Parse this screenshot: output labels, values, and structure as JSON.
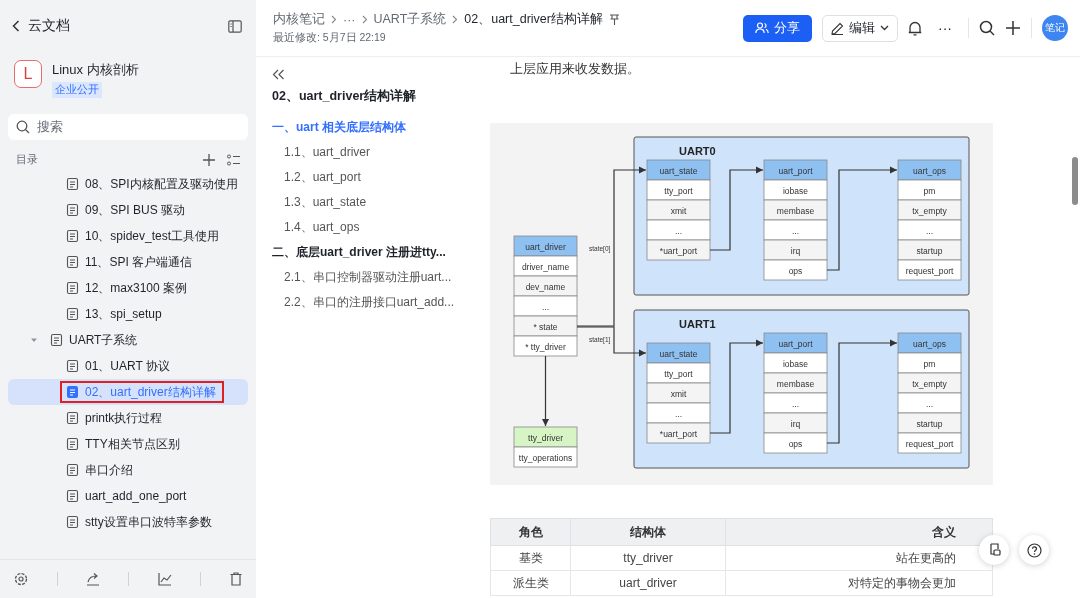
{
  "sidebar": {
    "back_label": "云文档",
    "space": {
      "initial": "L",
      "name": "Linux 内核剖析",
      "badge": "企业公开"
    },
    "search": {
      "placeholder": "搜索"
    },
    "toc_label": "目录",
    "tree_above": [
      {
        "label": "08、SPI内核配置及驱动使用",
        "selected": false,
        "highlighted": false
      },
      {
        "label": "09、SPI BUS 驱动",
        "selected": false,
        "highlighted": false
      },
      {
        "label": "10、spidev_test工具使用",
        "selected": false,
        "highlighted": false
      },
      {
        "label": "11、SPI 客户端通信",
        "selected": false,
        "highlighted": false
      },
      {
        "label": "12、max3100 案例",
        "selected": false,
        "highlighted": false
      },
      {
        "label": "13、spi_setup",
        "selected": false,
        "highlighted": false
      }
    ],
    "tree": [
      {
        "label": "UART子系统",
        "expanded": true,
        "selected": false,
        "highlighted": false,
        "children": [
          {
            "label": "01、UART 协议",
            "selected": false,
            "highlighted": false
          },
          {
            "label": "02、uart_driver结构详解",
            "selected": true,
            "highlighted": true
          },
          {
            "label": "printk执行过程",
            "selected": false,
            "highlighted": false
          },
          {
            "label": "TTY相关节点区别",
            "selected": false,
            "highlighted": false
          },
          {
            "label": "串口介绍",
            "selected": false,
            "highlighted": false
          },
          {
            "label": "uart_add_one_port",
            "selected": false,
            "highlighted": false
          },
          {
            "label": "stty设置串口波特率参数",
            "selected": false,
            "highlighted": false
          }
        ]
      }
    ]
  },
  "header": {
    "breadcrumb": [
      "内核笔记",
      "···",
      "UART子系统",
      "02、uart_driver结构详解"
    ],
    "last_modified": "最近修改: 5月7日 22:19",
    "share_button": "分享",
    "edit_button": "编辑",
    "more": "···",
    "avatar": "笔记"
  },
  "outline": {
    "title": "02、uart_driver结构详解",
    "sections": [
      {
        "label": "一、uart 相关底层结构体",
        "selected": true,
        "children": [
          {
            "label": "1.1、uart_driver"
          },
          {
            "label": "1.2、uart_port"
          },
          {
            "label": "1.3、uart_state"
          },
          {
            "label": "1.4、uart_ops"
          }
        ]
      },
      {
        "label": "二、底层uart_driver 注册进tty...",
        "selected": false,
        "children": [
          {
            "label": "2.1、串口控制器驱动注册uart..."
          },
          {
            "label": "2.2、串口的注册接口uart_add..."
          }
        ]
      }
    ]
  },
  "document": {
    "paragraph": "上层应用来收发数据。",
    "diagram": {
      "driver": {
        "title": "uart_driver",
        "fields": [
          "driver_name",
          "dev_name",
          "...",
          "* state",
          "* tty_driver"
        ]
      },
      "tty": {
        "title": "tty_driver",
        "fields": [
          "tty_operations"
        ]
      },
      "links": [
        "state[0]",
        "state[1]"
      ],
      "groups": [
        {
          "title": "UART0",
          "structs": [
            {
              "title": "uart_state",
              "fields": [
                "tty_port",
                "xmit",
                "...",
                "*uart_port"
              ]
            },
            {
              "title": "uart_port",
              "fields": [
                "iobase",
                "membase",
                "...",
                "irq",
                "ops"
              ]
            },
            {
              "title": "uart_ops",
              "fields": [
                "pm",
                "tx_empty",
                "...",
                "startup",
                "request_port"
              ]
            }
          ]
        },
        {
          "title": "UART1",
          "structs": [
            {
              "title": "uart_state",
              "fields": [
                "tty_port",
                "xmit",
                "...",
                "*uart_port"
              ]
            },
            {
              "title": "uart_port",
              "fields": [
                "iobase",
                "membase",
                "...",
                "irq",
                "ops"
              ]
            },
            {
              "title": "uart_ops",
              "fields": [
                "pm",
                "tx_empty",
                "...",
                "startup",
                "request_port"
              ]
            }
          ]
        }
      ]
    },
    "table": {
      "columns": [
        "角色",
        "结构体",
        "含义"
      ],
      "rows": [
        [
          "基类",
          "tty_driver",
          "站在更高的"
        ],
        [
          "派生类",
          "uart_driver",
          "对特定的事物会更加"
        ]
      ]
    }
  }
}
